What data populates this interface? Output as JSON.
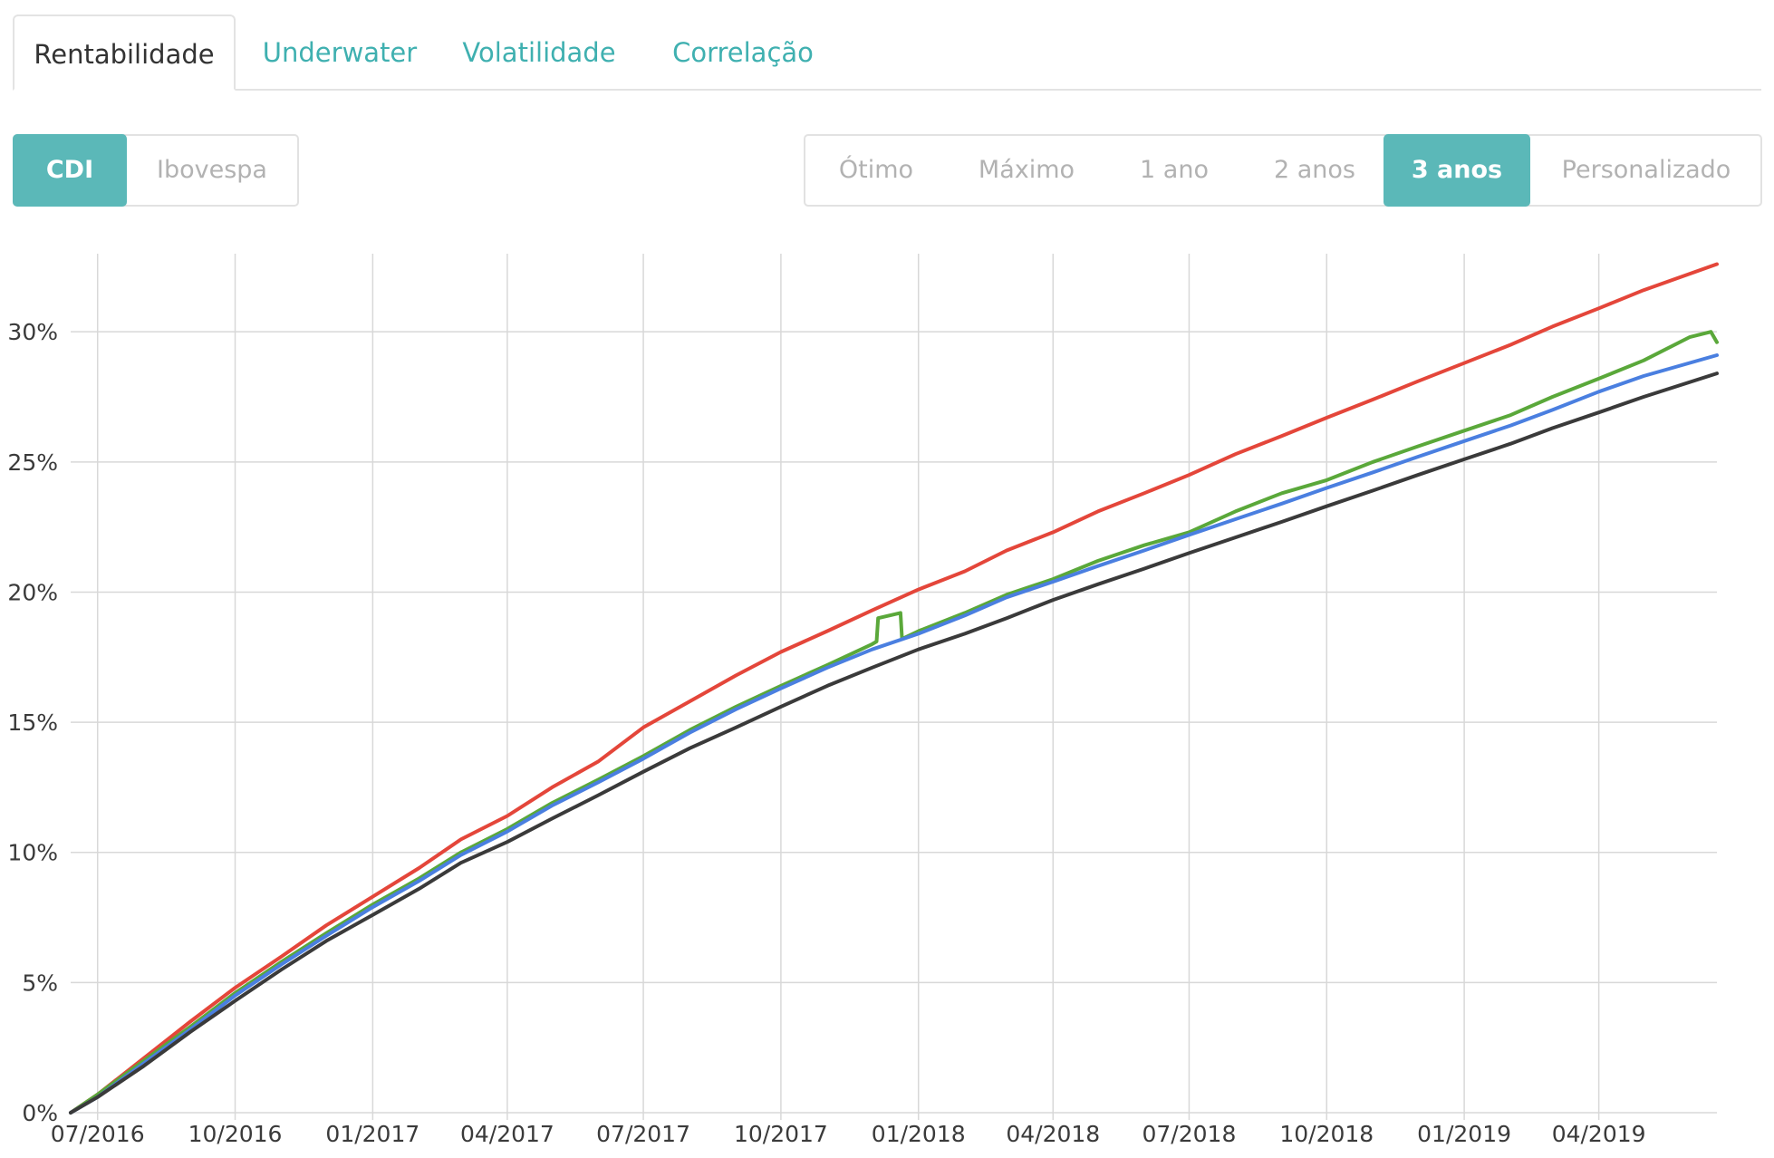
{
  "tabs": [
    {
      "label": "Rentabilidade",
      "active": true
    },
    {
      "label": "Underwater",
      "active": false
    },
    {
      "label": "Volatilidade",
      "active": false
    },
    {
      "label": "Correlação",
      "active": false
    }
  ],
  "benchmark_toggle": {
    "options": [
      "CDI",
      "Ibovespa"
    ],
    "selected": "CDI"
  },
  "period_selector": {
    "options": [
      "Ótimo",
      "Máximo",
      "1 ano",
      "2 anos",
      "3 anos",
      "Personalizado"
    ],
    "selected": "3 anos"
  },
  "colors": {
    "accent": "#5bb8b8",
    "tab_text": "#3fb0b0",
    "series_red": "#e4463a",
    "series_green": "#5aa83a",
    "series_blue": "#4a7fe0",
    "series_black": "#3a3a3a"
  },
  "chart_data": {
    "type": "line",
    "title": "",
    "xlabel": "",
    "ylabel": "",
    "ylim": [
      0,
      0.33
    ],
    "xlim": [
      "2016-06-13",
      "2019-06-19"
    ],
    "y_ticks": [
      {
        "value": 0.0,
        "label": "0%"
      },
      {
        "value": 0.05,
        "label": "5%"
      },
      {
        "value": 0.1,
        "label": "10%"
      },
      {
        "value": 0.15,
        "label": "15%"
      },
      {
        "value": 0.2,
        "label": "20%"
      },
      {
        "value": 0.25,
        "label": "25%"
      },
      {
        "value": 0.3,
        "label": "30%"
      }
    ],
    "x_ticks": [
      {
        "date": "2016-07-01",
        "label": "07/2016"
      },
      {
        "date": "2016-10-01",
        "label": "10/2016"
      },
      {
        "date": "2017-01-01",
        "label": "01/2017"
      },
      {
        "date": "2017-04-01",
        "label": "04/2017"
      },
      {
        "date": "2017-07-01",
        "label": "07/2017"
      },
      {
        "date": "2017-10-01",
        "label": "10/2017"
      },
      {
        "date": "2018-01-01",
        "label": "01/2018"
      },
      {
        "date": "2018-04-01",
        "label": "04/2018"
      },
      {
        "date": "2018-07-01",
        "label": "07/2018"
      },
      {
        "date": "2018-10-01",
        "label": "10/2018"
      },
      {
        "date": "2019-01-01",
        "label": "01/2019"
      },
      {
        "date": "2019-04-01",
        "label": "04/2019"
      }
    ],
    "grid": true,
    "legend": "none",
    "series": [
      {
        "color": "#e4463a",
        "points": [
          [
            "2016-06-13",
            0.0
          ],
          [
            "2016-07-01",
            0.007
          ],
          [
            "2016-08-01",
            0.021
          ],
          [
            "2016-09-01",
            0.035
          ],
          [
            "2016-10-01",
            0.048
          ],
          [
            "2016-11-01",
            0.06
          ],
          [
            "2016-12-01",
            0.072
          ],
          [
            "2017-01-01",
            0.083
          ],
          [
            "2017-02-01",
            0.094
          ],
          [
            "2017-03-01",
            0.105
          ],
          [
            "2017-04-01",
            0.114
          ],
          [
            "2017-05-01",
            0.125
          ],
          [
            "2017-06-01",
            0.135
          ],
          [
            "2017-07-01",
            0.148
          ],
          [
            "2017-08-01",
            0.158
          ],
          [
            "2017-09-01",
            0.168
          ],
          [
            "2017-10-01",
            0.177
          ],
          [
            "2017-11-01",
            0.185
          ],
          [
            "2017-12-01",
            0.193
          ],
          [
            "2018-01-01",
            0.201
          ],
          [
            "2018-02-01",
            0.208
          ],
          [
            "2018-03-01",
            0.216
          ],
          [
            "2018-04-01",
            0.223
          ],
          [
            "2018-05-01",
            0.231
          ],
          [
            "2018-06-01",
            0.238
          ],
          [
            "2018-07-01",
            0.245
          ],
          [
            "2018-08-01",
            0.253
          ],
          [
            "2018-09-01",
            0.26
          ],
          [
            "2018-10-01",
            0.267
          ],
          [
            "2018-11-01",
            0.274
          ],
          [
            "2018-12-01",
            0.281
          ],
          [
            "2019-01-01",
            0.288
          ],
          [
            "2019-02-01",
            0.295
          ],
          [
            "2019-03-01",
            0.302
          ],
          [
            "2019-04-01",
            0.309
          ],
          [
            "2019-05-01",
            0.316
          ],
          [
            "2019-06-19",
            0.326
          ]
        ]
      },
      {
        "color": "#5aa83a",
        "points": [
          [
            "2016-06-13",
            0.0
          ],
          [
            "2016-07-01",
            0.007
          ],
          [
            "2016-08-01",
            0.02
          ],
          [
            "2016-09-01",
            0.033
          ],
          [
            "2016-10-01",
            0.046
          ],
          [
            "2016-11-01",
            0.058
          ],
          [
            "2016-12-01",
            0.069
          ],
          [
            "2017-01-01",
            0.08
          ],
          [
            "2017-02-01",
            0.09
          ],
          [
            "2017-03-01",
            0.1
          ],
          [
            "2017-04-01",
            0.109
          ],
          [
            "2017-05-01",
            0.119
          ],
          [
            "2017-06-01",
            0.128
          ],
          [
            "2017-07-01",
            0.137
          ],
          [
            "2017-08-01",
            0.147
          ],
          [
            "2017-09-01",
            0.156
          ],
          [
            "2017-10-01",
            0.164
          ],
          [
            "2017-11-01",
            0.172
          ],
          [
            "2017-12-01",
            0.18
          ],
          [
            "2017-12-04",
            0.181
          ],
          [
            "2017-12-05",
            0.19
          ],
          [
            "2017-12-20",
            0.192
          ],
          [
            "2017-12-21",
            0.182
          ],
          [
            "2018-01-01",
            0.185
          ],
          [
            "2018-02-01",
            0.192
          ],
          [
            "2018-03-01",
            0.199
          ],
          [
            "2018-04-01",
            0.205
          ],
          [
            "2018-05-01",
            0.212
          ],
          [
            "2018-06-01",
            0.218
          ],
          [
            "2018-07-01",
            0.223
          ],
          [
            "2018-08-01",
            0.231
          ],
          [
            "2018-09-01",
            0.238
          ],
          [
            "2018-10-01",
            0.243
          ],
          [
            "2018-11-01",
            0.25
          ],
          [
            "2018-12-01",
            0.256
          ],
          [
            "2019-01-01",
            0.262
          ],
          [
            "2019-02-01",
            0.268
          ],
          [
            "2019-03-01",
            0.275
          ],
          [
            "2019-04-01",
            0.282
          ],
          [
            "2019-05-01",
            0.289
          ],
          [
            "2019-06-01",
            0.298
          ],
          [
            "2019-06-15",
            0.3
          ],
          [
            "2019-06-19",
            0.296
          ]
        ]
      },
      {
        "color": "#4a7fe0",
        "points": [
          [
            "2016-06-13",
            0.0
          ],
          [
            "2016-07-01",
            0.006
          ],
          [
            "2016-08-01",
            0.019
          ],
          [
            "2016-09-01",
            0.032
          ],
          [
            "2016-10-01",
            0.045
          ],
          [
            "2016-11-01",
            0.057
          ],
          [
            "2016-12-01",
            0.068
          ],
          [
            "2017-01-01",
            0.079
          ],
          [
            "2017-02-01",
            0.089
          ],
          [
            "2017-03-01",
            0.099
          ],
          [
            "2017-04-01",
            0.108
          ],
          [
            "2017-05-01",
            0.118
          ],
          [
            "2017-06-01",
            0.127
          ],
          [
            "2017-07-01",
            0.136
          ],
          [
            "2017-08-01",
            0.146
          ],
          [
            "2017-09-01",
            0.155
          ],
          [
            "2017-10-01",
            0.163
          ],
          [
            "2017-11-01",
            0.171
          ],
          [
            "2017-12-01",
            0.178
          ],
          [
            "2018-01-01",
            0.184
          ],
          [
            "2018-02-01",
            0.191
          ],
          [
            "2018-03-01",
            0.198
          ],
          [
            "2018-04-01",
            0.204
          ],
          [
            "2018-05-01",
            0.21
          ],
          [
            "2018-06-01",
            0.216
          ],
          [
            "2018-07-01",
            0.222
          ],
          [
            "2018-08-01",
            0.228
          ],
          [
            "2018-09-01",
            0.234
          ],
          [
            "2018-10-01",
            0.24
          ],
          [
            "2018-11-01",
            0.246
          ],
          [
            "2018-12-01",
            0.252
          ],
          [
            "2019-01-01",
            0.258
          ],
          [
            "2019-02-01",
            0.264
          ],
          [
            "2019-03-01",
            0.27
          ],
          [
            "2019-04-01",
            0.277
          ],
          [
            "2019-05-01",
            0.283
          ],
          [
            "2019-06-19",
            0.291
          ]
        ]
      },
      {
        "color": "#3a3a3a",
        "points": [
          [
            "2016-06-13",
            0.0
          ],
          [
            "2016-07-01",
            0.006
          ],
          [
            "2016-08-01",
            0.018
          ],
          [
            "2016-09-01",
            0.031
          ],
          [
            "2016-10-01",
            0.043
          ],
          [
            "2016-11-01",
            0.055
          ],
          [
            "2016-12-01",
            0.066
          ],
          [
            "2017-01-01",
            0.076
          ],
          [
            "2017-02-01",
            0.086
          ],
          [
            "2017-03-01",
            0.096
          ],
          [
            "2017-04-01",
            0.104
          ],
          [
            "2017-05-01",
            0.113
          ],
          [
            "2017-06-01",
            0.122
          ],
          [
            "2017-07-01",
            0.131
          ],
          [
            "2017-08-01",
            0.14
          ],
          [
            "2017-09-01",
            0.148
          ],
          [
            "2017-10-01",
            0.156
          ],
          [
            "2017-11-01",
            0.164
          ],
          [
            "2017-12-01",
            0.171
          ],
          [
            "2018-01-01",
            0.178
          ],
          [
            "2018-02-01",
            0.184
          ],
          [
            "2018-03-01",
            0.19
          ],
          [
            "2018-04-01",
            0.197
          ],
          [
            "2018-05-01",
            0.203
          ],
          [
            "2018-06-01",
            0.209
          ],
          [
            "2018-07-01",
            0.215
          ],
          [
            "2018-08-01",
            0.221
          ],
          [
            "2018-09-01",
            0.227
          ],
          [
            "2018-10-01",
            0.233
          ],
          [
            "2018-11-01",
            0.239
          ],
          [
            "2018-12-01",
            0.245
          ],
          [
            "2019-01-01",
            0.251
          ],
          [
            "2019-02-01",
            0.257
          ],
          [
            "2019-03-01",
            0.263
          ],
          [
            "2019-04-01",
            0.269
          ],
          [
            "2019-05-01",
            0.275
          ],
          [
            "2019-06-19",
            0.284
          ]
        ]
      }
    ]
  }
}
